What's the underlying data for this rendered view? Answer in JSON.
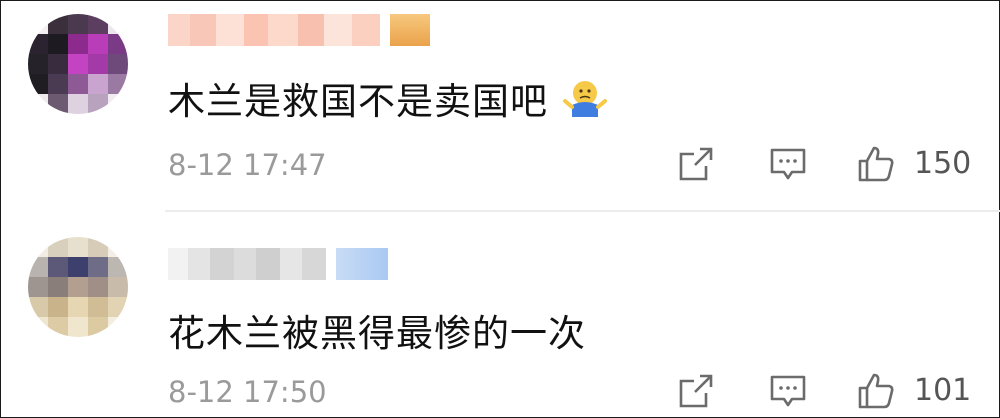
{
  "comments": [
    {
      "text": "木兰是救国不是卖国吧",
      "timestamp": "8-12 17:47",
      "likes": "150",
      "emoji": "shrug-emoji",
      "username_style": "pixelated-orange",
      "badge_color": "#f2b15a"
    },
    {
      "text": "花木兰被黑得最惨的一次",
      "timestamp": "8-12 17:50",
      "likes": "101",
      "username_style": "pixelated-gray",
      "badge_color": "#a9c9f2"
    }
  ],
  "icons": {
    "share": "share-icon",
    "reply": "comment-icon",
    "like": "thumbs-up-icon"
  },
  "colors": {
    "text": "#111111",
    "meta": "#9a9a9a",
    "icon": "#6b6b6b",
    "divider": "#ececec"
  }
}
